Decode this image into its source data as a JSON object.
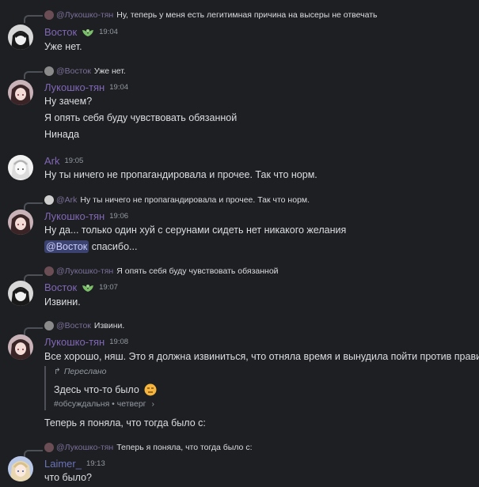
{
  "messages": [
    {
      "reply": {
        "name": "@Лукошко-тян",
        "text": "Ну, теперь у меня есть легитимная причина на высеры не отвечать"
      },
      "author": "Восток",
      "time": "19:04",
      "badge": "leaf-badge-icon",
      "lines": [
        "Уже нет."
      ]
    },
    {
      "reply": {
        "name": "@Восток",
        "text": "Уже нет."
      },
      "author": "Лукошко-тян",
      "time": "19:04",
      "lines": [
        "Ну зачем?",
        "Я опять себя буду чувствовать обязанной",
        "Нинада"
      ]
    },
    {
      "author": "Ark",
      "time": "19:05",
      "lines": [
        "Ну ты ничего не пропагандировала и прочее. Так что норм."
      ]
    },
    {
      "reply": {
        "name": "@Ark",
        "text": "Ну ты ничего не пропагандировала и прочее. Так что норм."
      },
      "author": "Лукошко-тян",
      "time": "19:06",
      "lines": [
        "Ну да... только один хуй с серунами сидеть нет никакого желания"
      ],
      "mention_line": {
        "mention": "@Восток",
        "text": " спасибо..."
      }
    },
    {
      "reply": {
        "name": "@Лукошко-тян",
        "text": "Я опять себя буду чувствовать обязанной"
      },
      "author": "Восток",
      "time": "19:07",
      "badge": "leaf-badge-icon",
      "lines": [
        "Извини."
      ]
    },
    {
      "reply": {
        "name": "@Восток",
        "text": "Извини."
      },
      "author": "Лукошко-тян",
      "time": "19:08",
      "lines": [
        "Все хорошо, няш. Это я должна извиниться, что отняла время и вынудила пойти против правил"
      ],
      "forwarded": {
        "label": "Переслано",
        "text": "Здесь что-то было",
        "emoji": "unamused-face-emoji",
        "source": "#обсуждальня • четверг",
        "chevron": "›"
      },
      "after": "Теперь я поняла, что тогда было с:"
    },
    {
      "reply": {
        "name": "@Лукошко-тян",
        "text": "Теперь я поняла, что тогда было с:"
      },
      "author": "Laimer_",
      "time": "19:13",
      "lines": [
        "что было?"
      ]
    }
  ],
  "colors": {
    "background": "#1e1f22",
    "username": "#8067b6",
    "mention_bg": "#3c4270",
    "text": "#dbdee1"
  }
}
